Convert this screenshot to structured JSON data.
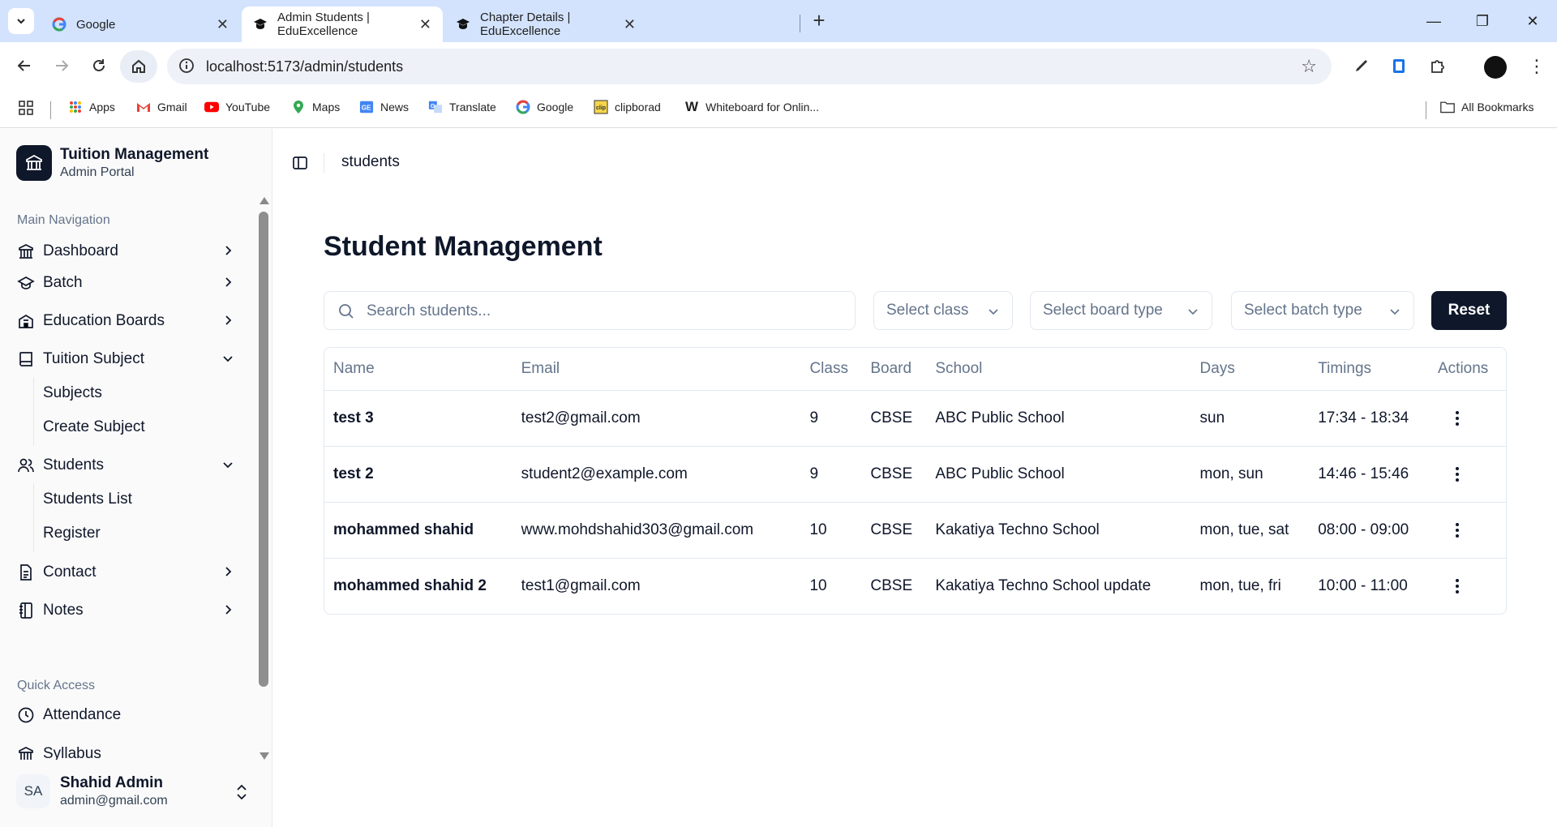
{
  "browser": {
    "tabs": [
      {
        "title": "Google",
        "favicon": "google-g-icon"
      },
      {
        "title": "Admin Students | EduExcellence",
        "favicon": "graduation-cap-icon",
        "active": true
      },
      {
        "title": "Chapter Details | EduExcellence",
        "favicon": "graduation-cap-icon"
      }
    ],
    "url": "localhost:5173/admin/students",
    "bookmarks": [
      {
        "label": "Apps",
        "icon": "apps-grid-icon"
      },
      {
        "label": "Gmail",
        "icon": "gmail-icon"
      },
      {
        "label": "YouTube",
        "icon": "youtube-icon"
      },
      {
        "label": "Maps",
        "icon": "maps-pin-icon"
      },
      {
        "label": "News",
        "icon": "news-icon"
      },
      {
        "label": "Translate",
        "icon": "translate-icon"
      },
      {
        "label": "Google",
        "icon": "google-g-icon"
      },
      {
        "label": "clipborad",
        "icon": "clipboard-icon"
      },
      {
        "label": "Whiteboard for Onlin...",
        "icon": "whiteboard-w-icon"
      }
    ],
    "all_bookmarks": "All Bookmarks"
  },
  "sidebar": {
    "brand_title": "Tuition Management",
    "brand_subtitle": "Admin Portal",
    "main_nav_label": "Main Navigation",
    "items": [
      {
        "label": "Dashboard",
        "icon": "dashboard-icon"
      },
      {
        "label": "Batch",
        "icon": "graduation-cap-icon"
      },
      {
        "label": "Education Boards",
        "icon": "school-building-icon"
      },
      {
        "label": "Tuition Subject",
        "icon": "book-icon",
        "expanded": true
      },
      {
        "label": "Students",
        "icon": "users-icon",
        "expanded": true
      },
      {
        "label": "Contact",
        "icon": "contact-file-icon"
      },
      {
        "label": "Notes",
        "icon": "notebook-icon"
      }
    ],
    "tuition_subject_children": [
      "Subjects",
      "Create Subject"
    ],
    "students_children": [
      "Students List",
      "Register"
    ],
    "quick_access_label": "Quick Access",
    "quick_items": [
      {
        "label": "Attendance",
        "icon": "clock-icon"
      },
      {
        "label": "Syllabus",
        "icon": "school-building-icon"
      }
    ],
    "user": {
      "initials": "SA",
      "name": "Shahid Admin",
      "email": "admin@gmail.com"
    }
  },
  "topbar": {
    "breadcrumb": "students"
  },
  "page": {
    "title": "Student Management",
    "search_placeholder": "Search students...",
    "filters": {
      "class": "Select class",
      "board": "Select board type",
      "batch": "Select batch type"
    },
    "reset_label": "Reset"
  },
  "table": {
    "headers": [
      "Name",
      "Email",
      "Class",
      "Board",
      "School",
      "Days",
      "Timings",
      "Actions"
    ],
    "rows": [
      {
        "name": "test 3",
        "email": "test2@gmail.com",
        "class": "9",
        "board": "CBSE",
        "school": "ABC Public School",
        "days": "sun",
        "timings": "17:34 - 18:34"
      },
      {
        "name": "test 2",
        "email": "student2@example.com",
        "class": "9",
        "board": "CBSE",
        "school": "ABC Public School",
        "days": "mon, sun",
        "timings": "14:46 - 15:46"
      },
      {
        "name": "mohammed shahid",
        "email": "www.mohdshahid303@gmail.com",
        "class": "10",
        "board": "CBSE",
        "school": "Kakatiya Techno School",
        "days": "mon, tue, sat",
        "timings": "08:00 - 09:00"
      },
      {
        "name": "mohammed shahid 2",
        "email": "test1@gmail.com",
        "class": "10",
        "board": "CBSE",
        "school": "Kakatiya Techno School update",
        "days": "mon, tue, fri",
        "timings": "10:00 - 11:00"
      }
    ]
  },
  "colors": {
    "primary": "#0f172a",
    "muted": "#64748b",
    "border": "#e2e8f0",
    "tabstrip": "#d3e3fd"
  }
}
